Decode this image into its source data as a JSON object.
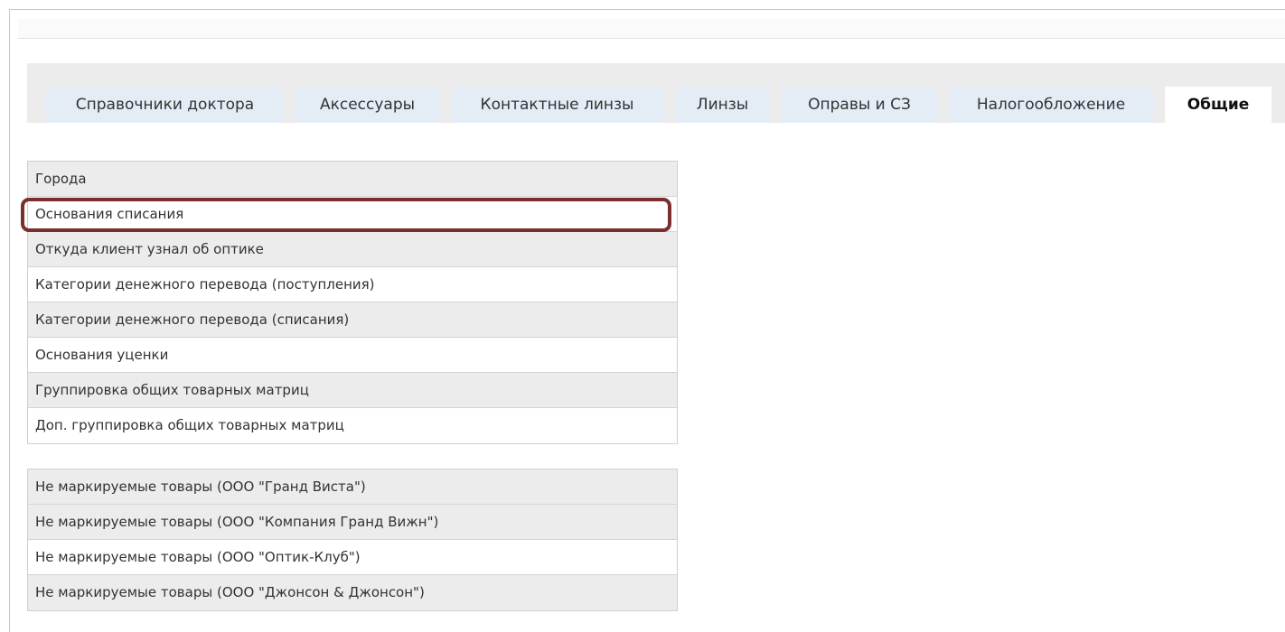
{
  "tabs": [
    {
      "label": "Справочники доктора"
    },
    {
      "label": "Аксессуары"
    },
    {
      "label": "Контактные линзы"
    },
    {
      "label": "Линзы"
    },
    {
      "label": "Оправы и СЗ"
    },
    {
      "label": "Налогообложение"
    },
    {
      "label": "Общие"
    }
  ],
  "active_tab": "Общие",
  "list_general": [
    {
      "label": "Города"
    },
    {
      "label": "Основания списания"
    },
    {
      "label": "Откуда клиент узнал об оптике"
    },
    {
      "label": "Категории денежного перевода (поступления)"
    },
    {
      "label": "Категории денежного перевода (списания)"
    },
    {
      "label": "Основания уценки"
    },
    {
      "label": "Группировка общих товарных матриц"
    },
    {
      "label": "Доп. группировка общих товарных матриц"
    }
  ],
  "list_unmarked": [
    {
      "label": "Не маркируемые товары (ООО \"Гранд Виста\")"
    },
    {
      "label": "Не маркируемые товары (ООО \"Компания Гранд Вижн\")"
    },
    {
      "label": "Не маркируемые товары (ООО \"Оптик-Клуб\")"
    },
    {
      "label": "Не маркируемые товары (ООО \"Джонсон & Джонсон\")"
    }
  ],
  "highlighted_item": "Основания списания",
  "colors": {
    "tab_bg": "#e4edf5",
    "tab_bar_bg": "#ececec",
    "row_odd_bg": "#ececec",
    "highlight_border": "#7a2e2e"
  }
}
